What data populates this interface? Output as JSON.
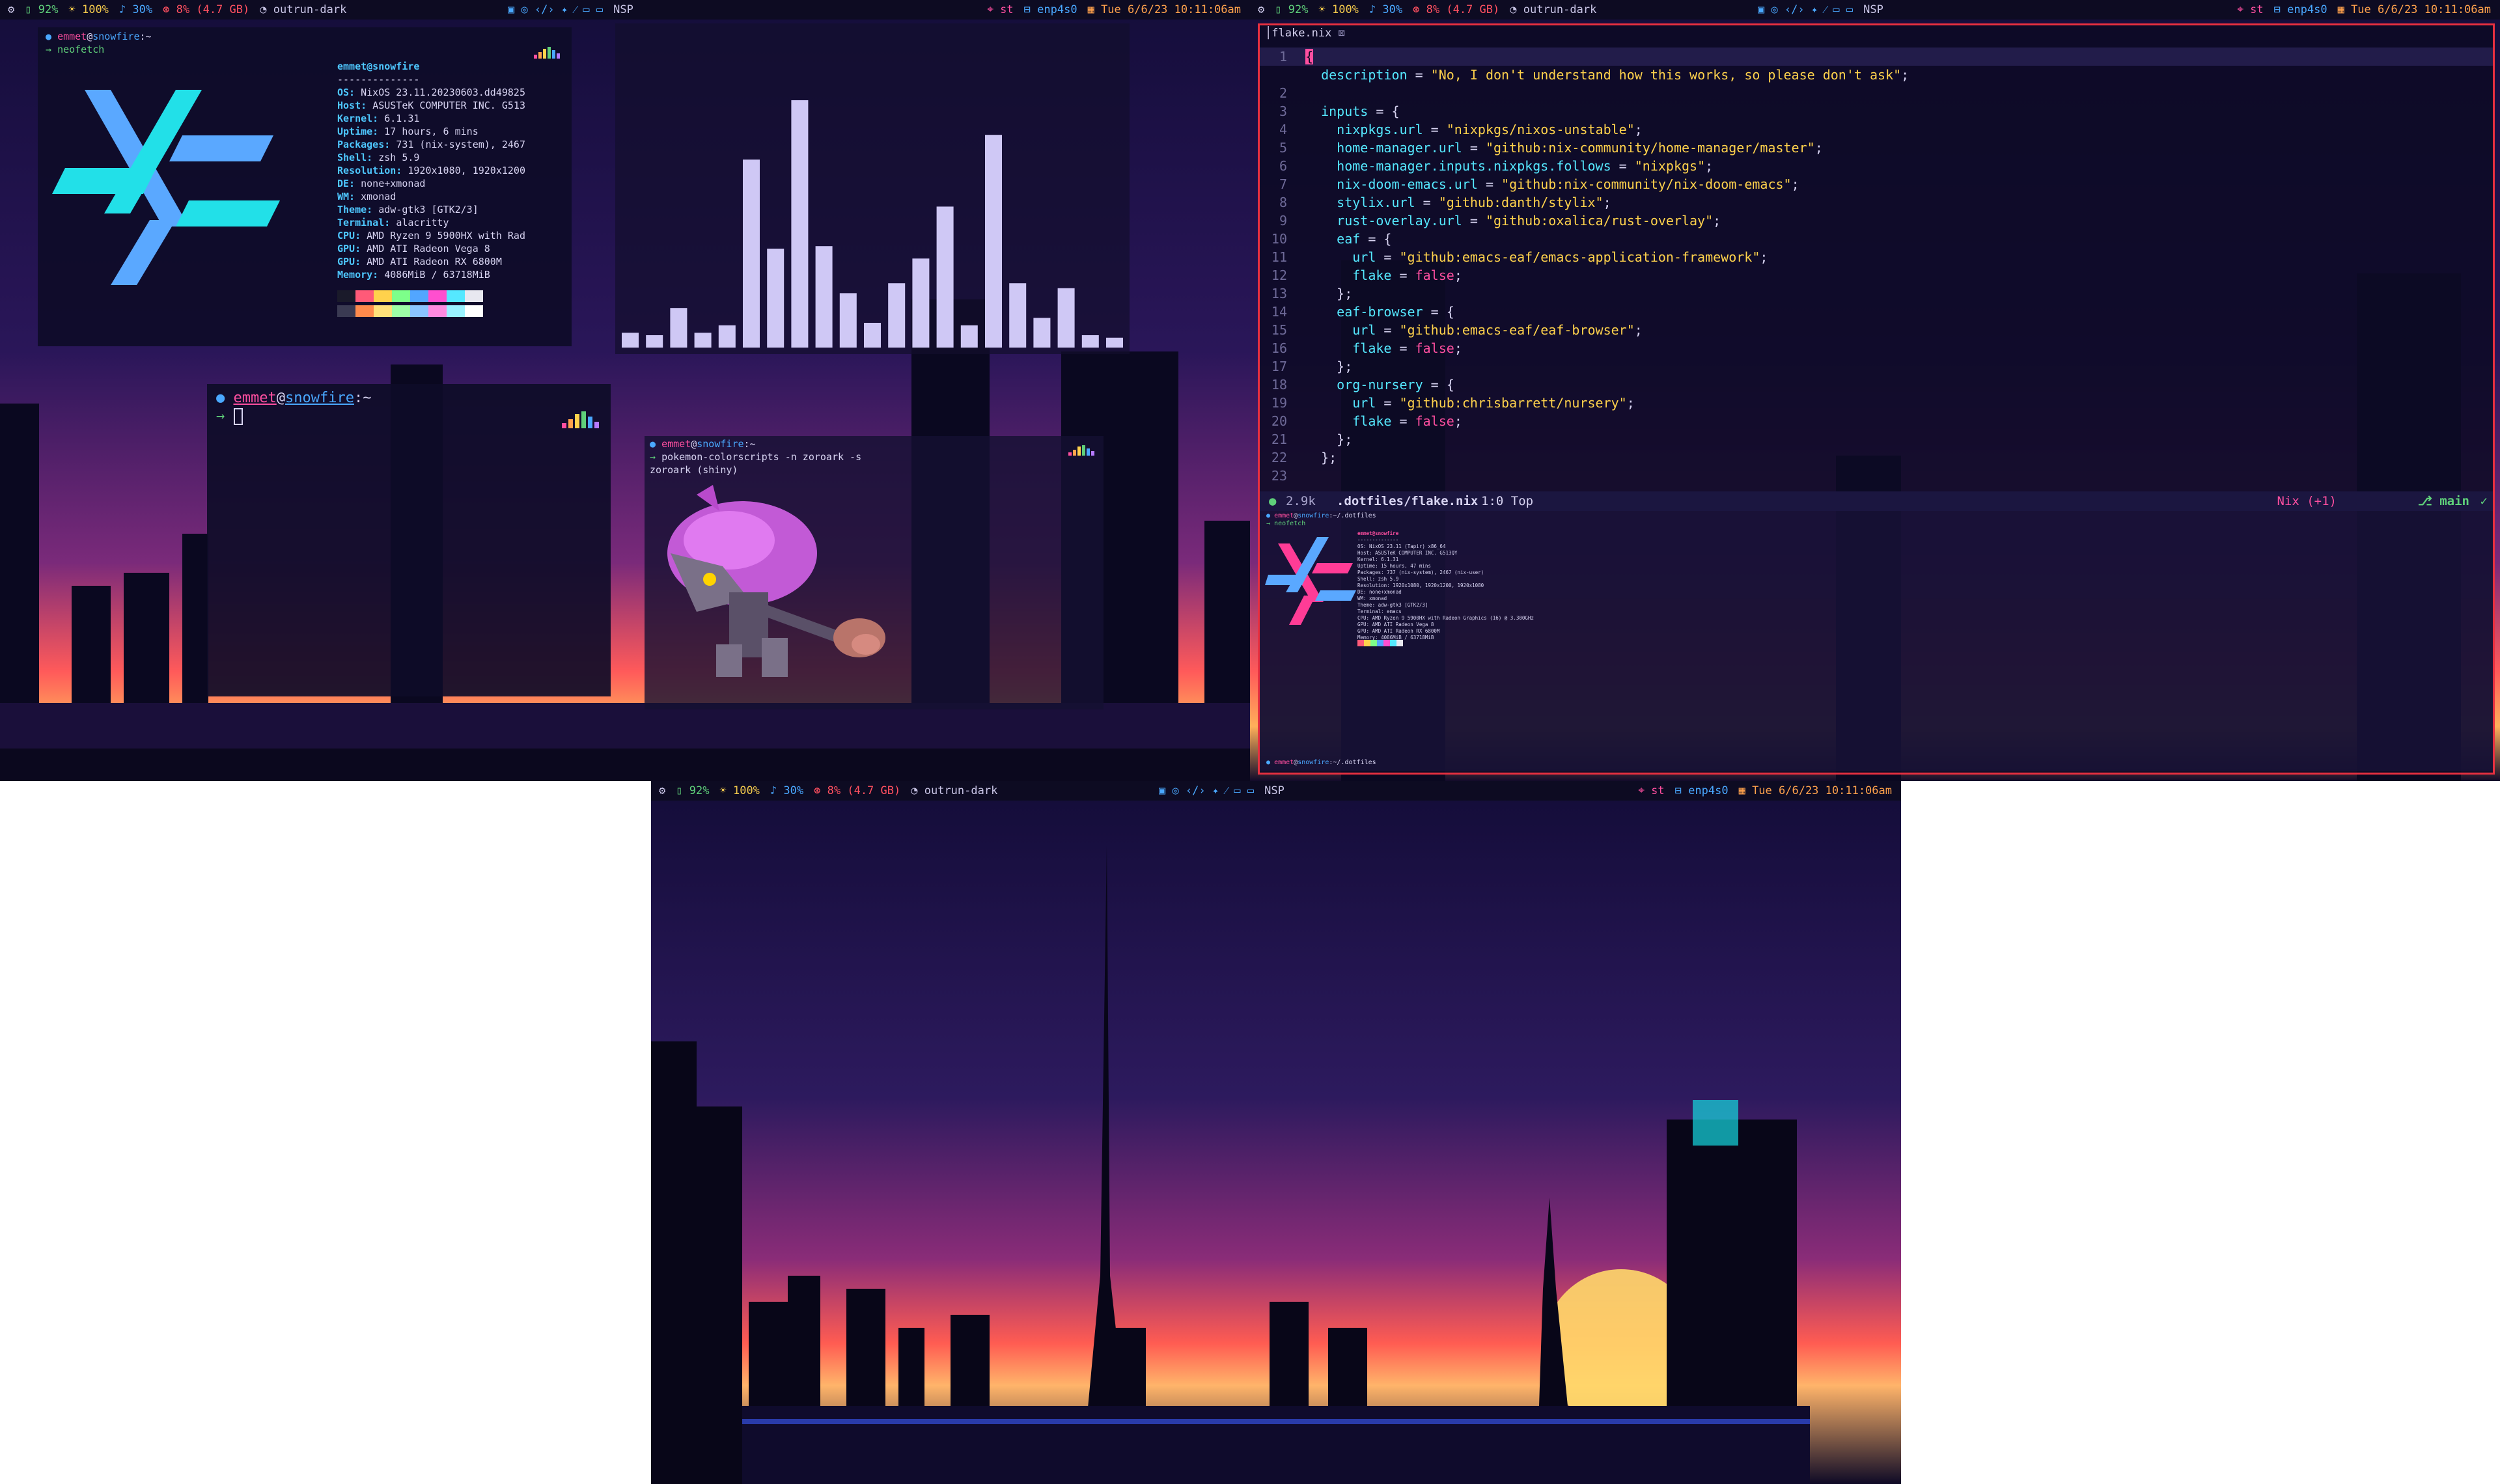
{
  "statusbar": {
    "left": [
      {
        "icon": "gear-icon",
        "text": ""
      },
      {
        "icon": "battery-icon",
        "text": "92%"
      },
      {
        "icon": "bulb-icon",
        "text": "100%"
      },
      {
        "icon": "speaker-icon",
        "text": "30%"
      },
      {
        "icon": "cpu-icon",
        "text": "8% (4.7 GB)"
      },
      {
        "icon": "theme-icon",
        "text": "outrun-dark"
      }
    ],
    "middle_label": "NSP",
    "right": [
      {
        "icon": "terminal-icon",
        "text": "st"
      },
      {
        "icon": "network-icon",
        "text": "enp4s0"
      },
      {
        "icon": "calendar-icon",
        "text": "Tue 6/6/23 10:11:06am"
      }
    ]
  },
  "neofetch": {
    "prompt_user": "emmet",
    "prompt_at": "@",
    "prompt_host": "snowfire",
    "prompt_path": ":~",
    "command": "neofetch",
    "title": "emmet@snowfire",
    "separator": "--------------",
    "rows": [
      {
        "k": "OS:",
        "v": "NixOS 23.11.20230603.dd49825"
      },
      {
        "k": "Host:",
        "v": "ASUSTeK COMPUTER INC. G513"
      },
      {
        "k": "Kernel:",
        "v": "6.1.31"
      },
      {
        "k": "Uptime:",
        "v": "17 hours, 6 mins"
      },
      {
        "k": "Packages:",
        "v": "731 (nix-system), 2467"
      },
      {
        "k": "Shell:",
        "v": "zsh 5.9"
      },
      {
        "k": "Resolution:",
        "v": "1920x1080, 1920x1200"
      },
      {
        "k": "DE:",
        "v": "none+xmonad"
      },
      {
        "k": "WM:",
        "v": "xmonad"
      },
      {
        "k": "Theme:",
        "v": "adw-gtk3 [GTK2/3]"
      },
      {
        "k": "Terminal:",
        "v": "alacritty"
      },
      {
        "k": "CPU:",
        "v": "AMD Ryzen 9 5900HX with Rad"
      },
      {
        "k": "GPU:",
        "v": "AMD ATI Radeon Vega 8"
      },
      {
        "k": "GPU:",
        "v": "AMD ATI Radeon RX 6800M"
      },
      {
        "k": "Memory:",
        "v": "4086MiB / 63718MiB"
      }
    ]
  },
  "colors": {
    "accent_pink": "#ff4fa0",
    "accent_blue": "#4aa8ff",
    "accent_cyan": "#55e8ff",
    "accent_yellow": "#ffd24c",
    "border_red": "#e83040",
    "bar_bg": "#0d0b22",
    "swatches_top": [
      "#1a1a2a",
      "#ff5a78",
      "#ffd24c",
      "#7dff8a",
      "#52a6ff",
      "#ff4fcf",
      "#55e8ff",
      "#e8e8f0"
    ],
    "swatches_bottom": [
      "#3a3a52",
      "#ff8a4c",
      "#ffe27a",
      "#9dffa6",
      "#8ac4ff",
      "#ff8ae0",
      "#9af2ff",
      "#ffffff"
    ]
  },
  "visualizer": {
    "values": [
      0.06,
      0.05,
      0.16,
      0.06,
      0.09,
      0.76,
      0.4,
      1.0,
      0.41,
      0.22,
      0.1,
      0.26,
      0.36,
      0.57,
      0.09,
      0.86,
      0.26,
      0.12,
      0.24,
      0.05,
      0.04
    ],
    "color": "#cfc8f5"
  },
  "term2": {
    "prompt_user": "emmet",
    "prompt_at": "@",
    "prompt_host": "snowfire",
    "prompt_path": ":~"
  },
  "pokemon": {
    "prompt_user": "emmet",
    "prompt_at": "@",
    "prompt_host": "snowfire",
    "prompt_path": ":~",
    "command": "pokemon-colorscripts -n zoroark -s",
    "output": "zoroark (shiny)"
  },
  "editor": {
    "tab_label": "flake.nix",
    "lines": [
      {
        "n": "1",
        "t": "{"
      },
      {
        "n": "",
        "t": "  description = \"No, I don't understand how this works, so please don't ask\";"
      },
      {
        "n": "2",
        "t": ""
      },
      {
        "n": "3",
        "t": "  inputs = {"
      },
      {
        "n": "4",
        "t": "    nixpkgs.url = \"nixpkgs/nixos-unstable\";"
      },
      {
        "n": "5",
        "t": "    home-manager.url = \"github:nix-community/home-manager/master\";"
      },
      {
        "n": "6",
        "t": "    home-manager.inputs.nixpkgs.follows = \"nixpkgs\";"
      },
      {
        "n": "7",
        "t": "    nix-doom-emacs.url = \"github:nix-community/nix-doom-emacs\";"
      },
      {
        "n": "8",
        "t": "    stylix.url = \"github:danth/stylix\";"
      },
      {
        "n": "9",
        "t": "    rust-overlay.url = \"github:oxalica/rust-overlay\";"
      },
      {
        "n": "10",
        "t": "    eaf = {"
      },
      {
        "n": "11",
        "t": "      url = \"github:emacs-eaf/emacs-application-framework\";"
      },
      {
        "n": "12",
        "t": "      flake = false;"
      },
      {
        "n": "13",
        "t": "    };"
      },
      {
        "n": "14",
        "t": "    eaf-browser = {"
      },
      {
        "n": "15",
        "t": "      url = \"github:emacs-eaf/eaf-browser\";"
      },
      {
        "n": "16",
        "t": "      flake = false;"
      },
      {
        "n": "17",
        "t": "    };"
      },
      {
        "n": "18",
        "t": "    org-nursery = {"
      },
      {
        "n": "19",
        "t": "      url = \"github:chrisbarrett/nursery\";"
      },
      {
        "n": "20",
        "t": "      flake = false;"
      },
      {
        "n": "21",
        "t": "    };"
      },
      {
        "n": "22",
        "t": "  };"
      },
      {
        "n": "23",
        "t": ""
      }
    ],
    "modeline": {
      "size": "2.9k",
      "file": ".dotfiles/flake.nix",
      "pos": "1:0 Top",
      "mode": "Nix (+1)",
      "branch": "main"
    },
    "mini": {
      "prompt_path": "~/.dotfiles",
      "command": "neofetch",
      "rows": [
        "OS: NixOS 23.11 (Tapir) x86_64",
        "Host: ASUSTeK COMPUTER INC. G513QY",
        "Kernel: 6.1.31",
        "Uptime: 15 hours, 47 mins",
        "Packages: 737 (nix-system), 2467 (nix-user)",
        "Shell: zsh 5.9",
        "Resolution: 1920x1080, 1920x1200, 1920x1080",
        "DE: none+xmonad",
        "WM: xmonad",
        "Theme: adw-gtk3 [GTK2/3]",
        "Terminal: emacs",
        "CPU: AMD Ryzen 9 5900HX with Radeon Graphics (16) @ 3.300GHz",
        "GPU: AMD ATI Radeon Vega 8",
        "GPU: AMD ATI Radeon RX 6800M",
        "Memory: 4086MiB / 63718MiB"
      ]
    }
  }
}
